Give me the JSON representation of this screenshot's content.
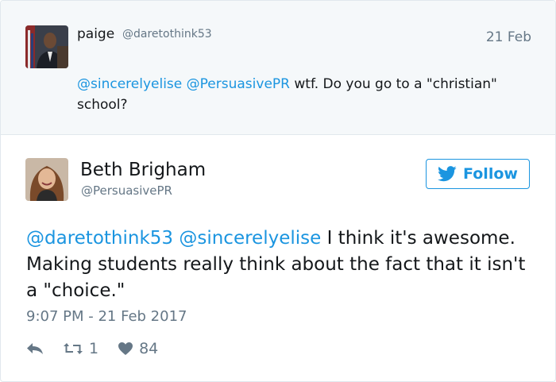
{
  "reply": {
    "name": "paige",
    "handle": "@daretothink53",
    "date": "21 Feb",
    "mention1": "@sincerelyelise",
    "mention2": "@PersuasivePR",
    "text": " wtf. Do you go to a \"christian\" school?"
  },
  "tweet": {
    "name": "Beth Brigham",
    "handle": "@PersuasivePR",
    "follow_label": "Follow",
    "mention1": "@daretothink53",
    "mention2": "@sincerelyelise",
    "text": " I think it's awesome. Making students really think about the fact that it isn't a \"choice.\"",
    "timestamp": "9:07 PM - 21 Feb 2017",
    "retweets": "1",
    "likes": "84"
  },
  "colors": {
    "link": "#1b95e0",
    "muted": "#657786",
    "reply_bg": "#f5f8fa"
  },
  "icons": [
    "reply-icon",
    "retweet-icon",
    "heart-icon",
    "twitter-bird-icon"
  ]
}
